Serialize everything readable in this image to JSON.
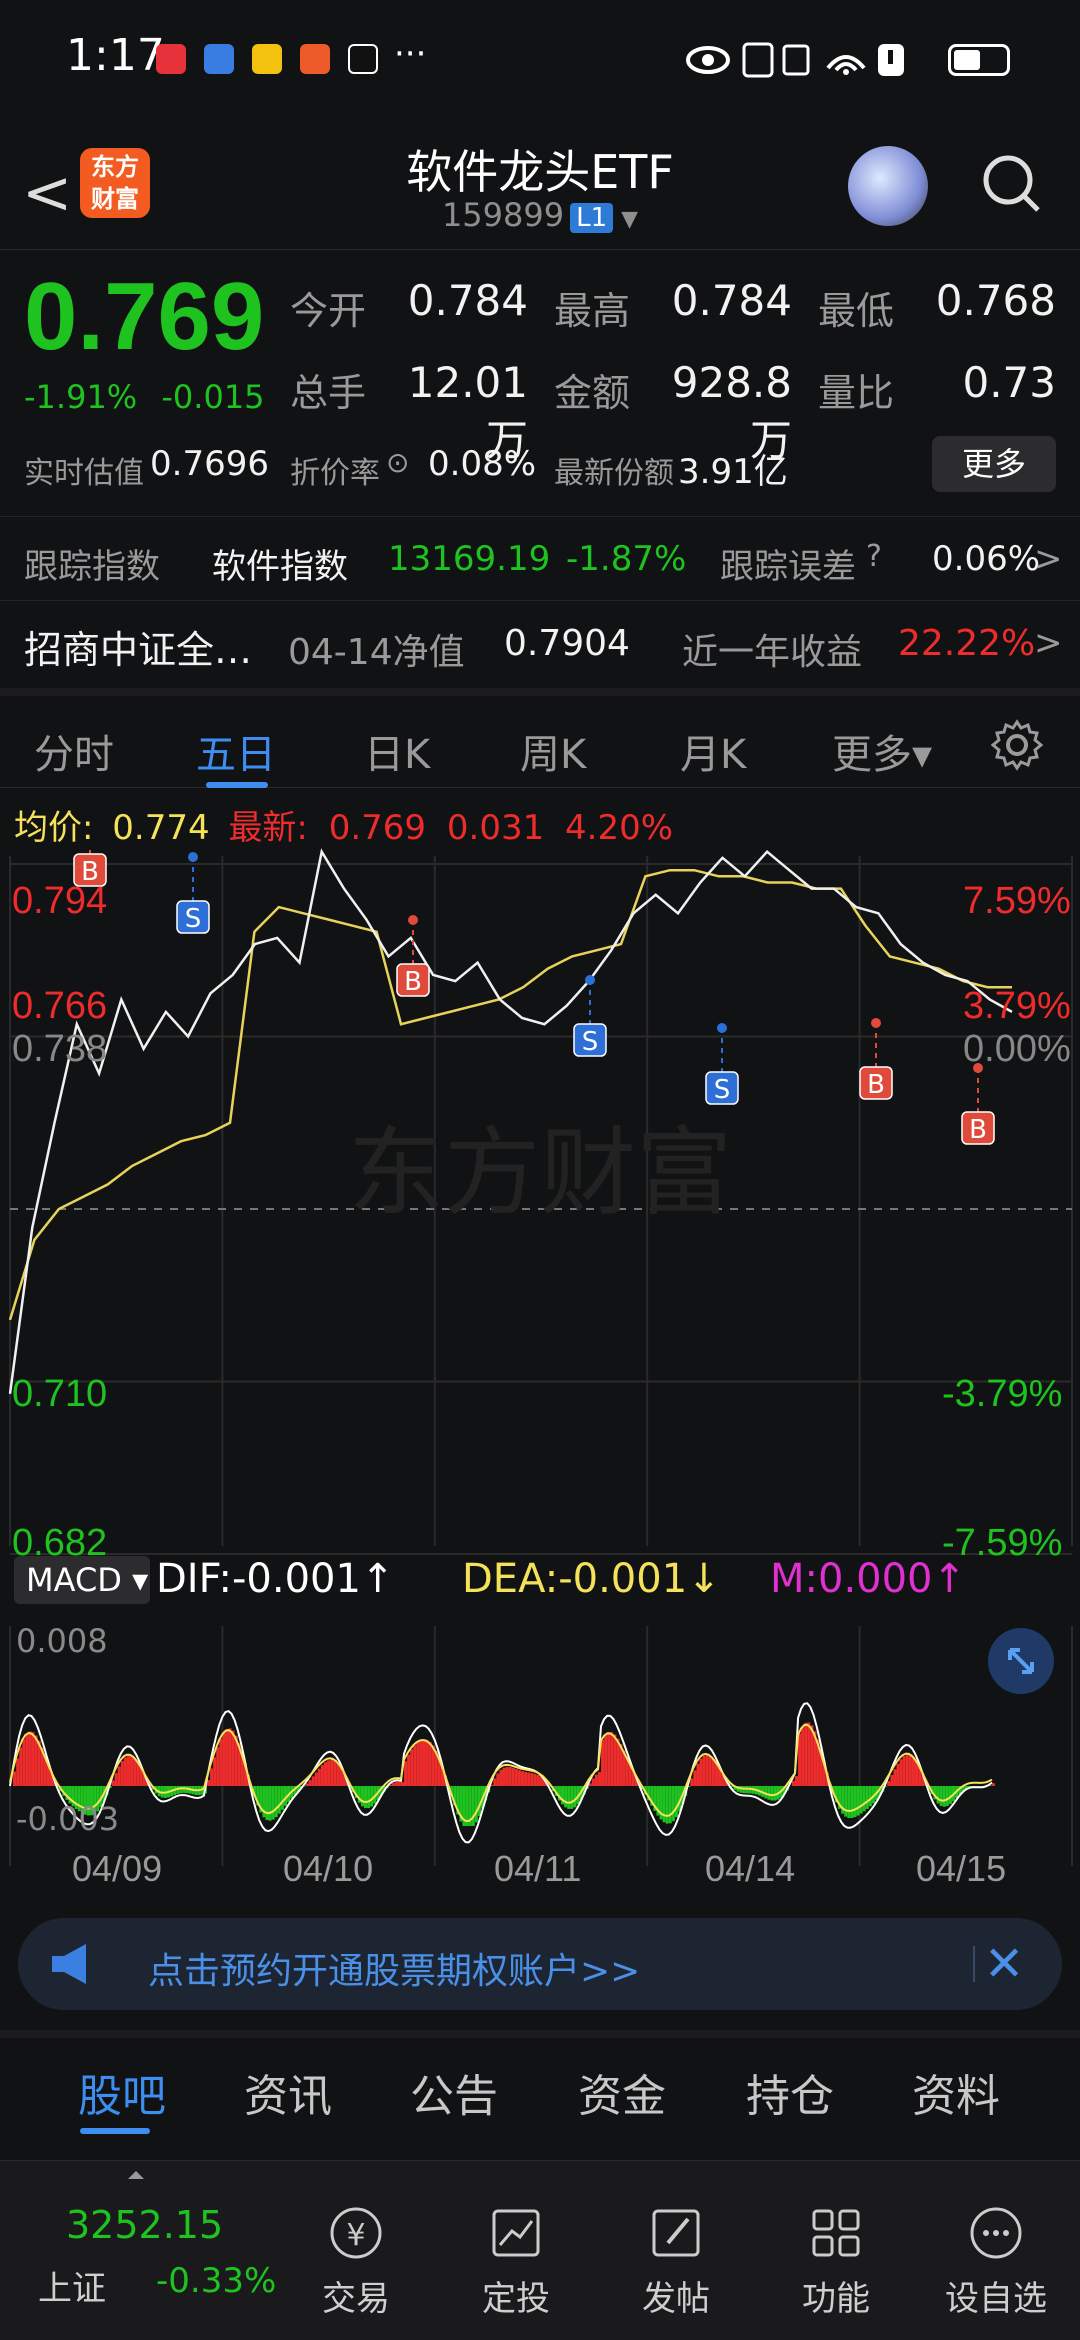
{
  "status": {
    "time": "1:17",
    "more": "···",
    "apps": [
      "#e5323b",
      "#3a7de0",
      "#f3c20e",
      "#ee5b2a",
      "#111111"
    ]
  },
  "header": {
    "back": "<",
    "logo": "东方财富",
    "title": "软件龙头ETF",
    "code": "159899",
    "level": "L1"
  },
  "quote": {
    "price": "0.769",
    "change_pct": "-1.91%",
    "change": "-0.015",
    "open_label": "今开",
    "open": "0.784",
    "high_label": "最高",
    "high": "0.784",
    "low_label": "最低",
    "low": "0.768",
    "volume_label": "总手",
    "volume": "12.01万",
    "amount_label": "金额",
    "amount": "928.8万",
    "ratio_label": "量比",
    "ratio": "0.73",
    "iopv_label": "实时估值",
    "iopv": "0.7696",
    "premium_label": "折价率",
    "premium": "0.08%",
    "shares_label": "最新份额",
    "shares": "3.91亿",
    "more_label": "更多"
  },
  "tracking": {
    "label": "跟踪指数",
    "index_name": "软件指数",
    "index_value": "13169.19",
    "index_change": "-1.87%",
    "error_label": "跟踪误差",
    "error_value": "0.06%",
    "arrow": ">"
  },
  "fund": {
    "name": "招商中证全…",
    "nav_label": "04-14净值",
    "nav_value": "0.7904",
    "return_label": "近一年收益",
    "return_value": "22.22%",
    "arrow": ">"
  },
  "tabs": [
    "分时",
    "五日",
    "日K",
    "周K",
    "月K",
    "更多▾"
  ],
  "chart_header": {
    "avg_label": "均价:",
    "avg_value": "0.774",
    "latest_label": "最新:",
    "latest_value": "0.769",
    "latest_change": "0.031",
    "latest_pct": "4.20%"
  },
  "chart_data": {
    "type": "line",
    "x_labels": [
      "04/09",
      "04/10",
      "04/11",
      "04/14",
      "04/15"
    ],
    "y_left_ticks": [
      "0.794",
      "0.766",
      "0.738",
      "0.710",
      "0.682"
    ],
    "y_right_ticks": [
      "7.59%",
      "3.79%",
      "0.00%",
      "-3.79%",
      "-7.59%"
    ],
    "ylim": [
      0.682,
      0.794
    ],
    "baseline": 0.738,
    "watermark": "东方财富",
    "series": [
      {
        "values": [
          0.708,
          0.735,
          0.752,
          0.768,
          0.76,
          0.772,
          0.764,
          0.77,
          0.766,
          0.773,
          0.776,
          0.781,
          0.782,
          0.778,
          0.796,
          0.79,
          0.785,
          0.779,
          0.782,
          0.776,
          0.775,
          0.778,
          0.772,
          0.769,
          0.768,
          0.771,
          0.775,
          0.78,
          0.786,
          0.789,
          0.786,
          0.791,
          0.795,
          0.792,
          0.796,
          0.793,
          0.79,
          0.79,
          0.787,
          0.786,
          0.781,
          0.778,
          0.776,
          0.775,
          0.772,
          0.77
        ]
      },
      {
        "values": [
          0.72,
          0.733,
          0.738,
          0.74,
          0.742,
          0.745,
          0.747,
          0.749,
          0.75,
          0.752,
          0.783,
          0.787,
          0.786,
          0.785,
          0.784,
          0.783,
          0.768,
          0.769,
          0.77,
          0.771,
          0.772,
          0.774,
          0.777,
          0.779,
          0.78,
          0.781,
          0.792,
          0.793,
          0.793,
          0.792,
          0.792,
          0.791,
          0.791,
          0.79,
          0.79,
          0.784,
          0.779,
          0.778,
          0.777,
          0.775,
          0.774,
          0.774
        ]
      }
    ],
    "signals": [
      {
        "type": "B",
        "day": "04/09"
      },
      {
        "type": "S",
        "day": "04/09"
      },
      {
        "type": "B",
        "day": "04/10"
      },
      {
        "type": "S",
        "day": "04/11"
      },
      {
        "type": "S",
        "day": "04/14"
      },
      {
        "type": "B",
        "day": "04/15"
      },
      {
        "type": "B",
        "day": "04/15"
      }
    ]
  },
  "macd": {
    "selector": "MACD ▾",
    "dif": "DIF:-0.001↑",
    "dea": "DEA:-0.001↓",
    "m": "M:0.000↑",
    "top_tick": "0.008",
    "bottom_tick": "-0.003",
    "colors": {
      "dif": "#ffffff",
      "dea": "#f5e15a",
      "m": "#e030d0",
      "up": "#ef2c2c",
      "down": "#1fc31f"
    }
  },
  "banner": {
    "text": "点击预约开通股票期权账户>>",
    "close": "✕"
  },
  "bottom_tabs": [
    "股吧",
    "资讯",
    "公告",
    "资金",
    "持仓",
    "资料"
  ],
  "bottom_nav": {
    "index_value": "3252.15",
    "index_name": "上证",
    "index_change": "-0.33%",
    "items": [
      {
        "label": "交易",
        "icon": "yen-icon"
      },
      {
        "label": "定投",
        "icon": "chart-up-icon"
      },
      {
        "label": "发帖",
        "icon": "edit-icon"
      },
      {
        "label": "功能",
        "icon": "grid-icon"
      },
      {
        "label": "设自选",
        "icon": "more-circle-icon"
      }
    ]
  }
}
